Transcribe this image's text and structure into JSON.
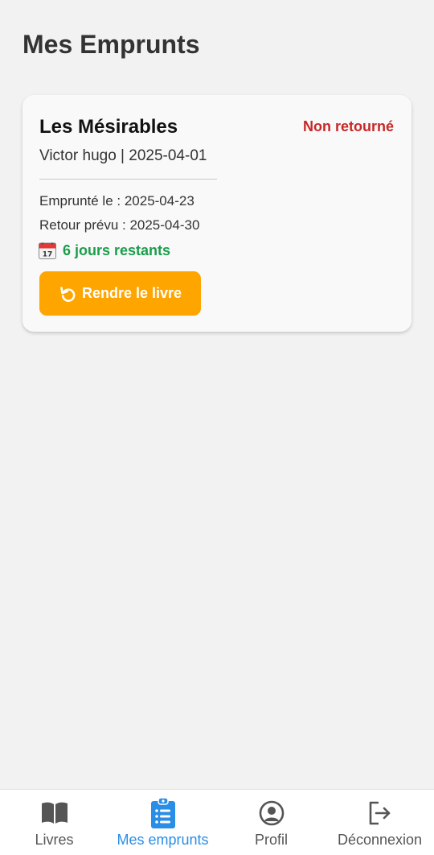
{
  "header": {
    "title": "Mes Emprunts"
  },
  "loans": [
    {
      "title": "Les Mésirables",
      "status": "Non retourné",
      "meta": "Victor hugo | 2025-04-01",
      "borrowed": "Emprunté le : 2025-04-23",
      "due": "Retour prévu : 2025-04-30",
      "remaining": "6 jours restants",
      "remaining_icon": "calendar-icon",
      "return_button": "Rendre le livre",
      "return_icon": "undo-icon"
    }
  ],
  "nav": {
    "active_index": 1,
    "items": [
      {
        "label": "Livres",
        "icon": "book-icon"
      },
      {
        "label": "Mes emprunts",
        "icon": "clipboard-list-icon"
      },
      {
        "label": "Profil",
        "icon": "user-circle-icon"
      },
      {
        "label": "Déconnexion",
        "icon": "logout-icon"
      }
    ]
  },
  "colors": {
    "background": "#f2f2f2",
    "status_red": "#c62828",
    "remaining_green": "#1a9e4b",
    "button_orange": "#ffa500",
    "nav_active": "#2a8ee6",
    "nav_inactive": "#555555"
  }
}
